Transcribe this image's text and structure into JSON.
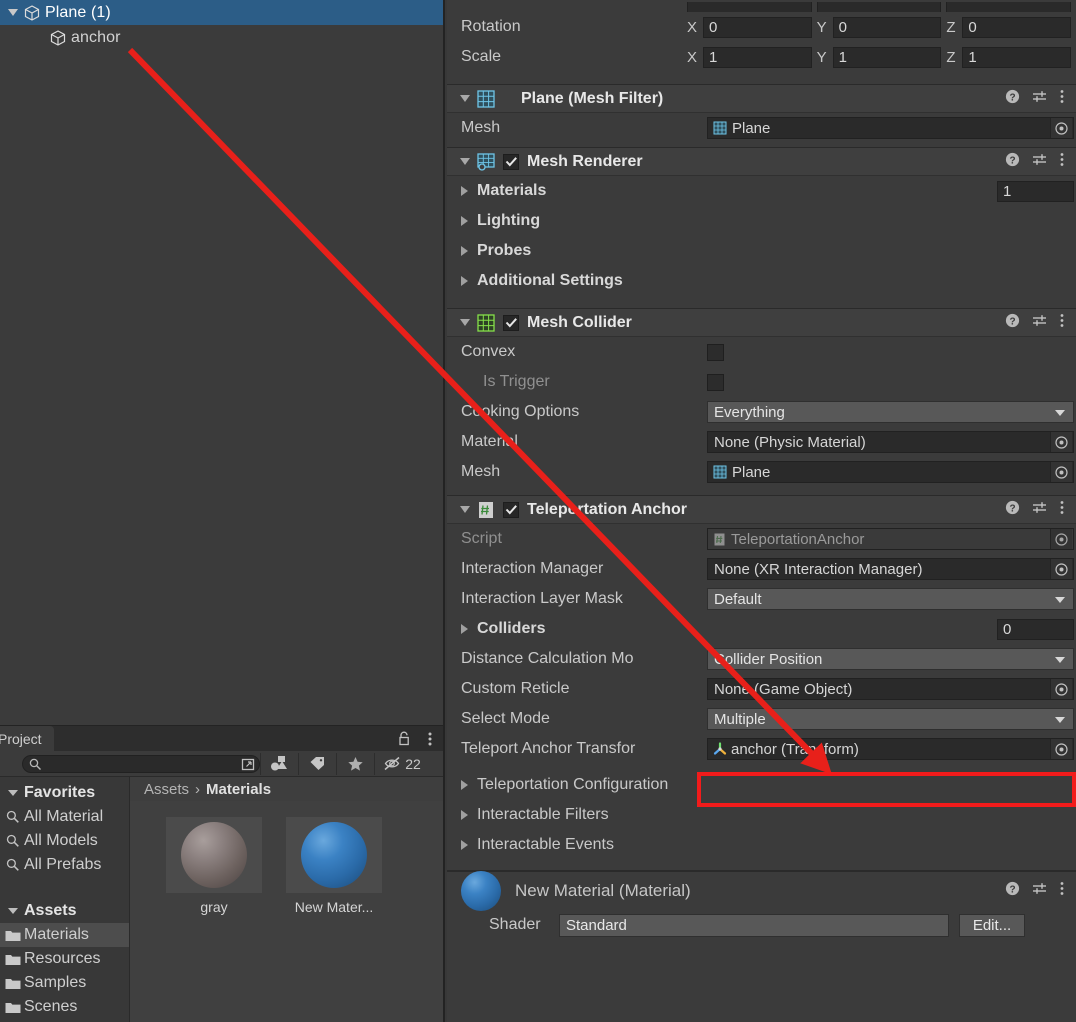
{
  "hierarchy": {
    "items": [
      {
        "label": "Plane (1)",
        "icon": "gameobject-icon",
        "selected": true,
        "expanded": true,
        "depth": 0
      },
      {
        "label": "anchor",
        "icon": "gameobject-icon",
        "selected": false,
        "expanded": false,
        "depth": 1
      }
    ]
  },
  "project": {
    "tab_label": "Project",
    "search_placeholder": "",
    "search_value": "",
    "hidden_count": "22",
    "tree": [
      {
        "label": "Favorites",
        "type": "header"
      },
      {
        "label": "All Material",
        "type": "search"
      },
      {
        "label": "All Models",
        "type": "search"
      },
      {
        "label": "All Prefabs",
        "type": "search"
      },
      {
        "label": "Assets",
        "type": "header"
      },
      {
        "label": "Materials",
        "type": "folder",
        "selected": true
      },
      {
        "label": "Resources",
        "type": "folder"
      },
      {
        "label": "Samples",
        "type": "folder"
      },
      {
        "label": "Scenes",
        "type": "folder"
      }
    ],
    "breadcrumb": [
      "Assets",
      "Materials"
    ],
    "assets": [
      {
        "name": "gray",
        "swatch": "gray"
      },
      {
        "name": "New Mater...",
        "swatch": "blue"
      }
    ]
  },
  "inspector": {
    "transform": {
      "rotation": {
        "label": "Rotation",
        "x": "0",
        "y": "0",
        "z": "0"
      },
      "scale": {
        "label": "Scale",
        "x": "1",
        "y": "1",
        "z": "1"
      },
      "axis_x": "X",
      "axis_y": "Y",
      "axis_z": "Z"
    },
    "mesh_filter": {
      "title": "Plane (Mesh Filter)",
      "mesh_label": "Mesh",
      "mesh_value": "Plane"
    },
    "mesh_renderer": {
      "title": "Mesh Renderer",
      "enabled": true,
      "sections": [
        "Materials",
        "Lighting",
        "Probes",
        "Additional Settings"
      ],
      "materials_count": "1"
    },
    "mesh_collider": {
      "title": "Mesh Collider",
      "enabled": true,
      "convex_label": "Convex",
      "convex_checked": false,
      "is_trigger_label": "Is Trigger",
      "is_trigger_checked": false,
      "cooking_label": "Cooking Options",
      "cooking_value": "Everything",
      "material_label": "Material",
      "material_value": "None (Physic Material)",
      "mesh_label": "Mesh",
      "mesh_value": "Plane"
    },
    "teleportation_anchor": {
      "title": "Teleportation Anchor",
      "enabled": true,
      "script_label": "Script",
      "script_value": "TeleportationAnchor",
      "interaction_manager_label": "Interaction Manager",
      "interaction_manager_value": "None (XR Interaction Manager)",
      "layer_mask_label": "Interaction Layer Mask",
      "layer_mask_value": "Default",
      "colliders_label": "Colliders",
      "colliders_count": "0",
      "distance_mode_label": "Distance Calculation Mo",
      "distance_mode_value": "Collider Position",
      "custom_reticle_label": "Custom Reticle",
      "custom_reticle_value": "None (Game Object)",
      "select_mode_label": "Select Mode",
      "select_mode_value": "Multiple",
      "anchor_transform_label": "Teleport Anchor Transfor",
      "anchor_transform_value": "anchor (Transform)",
      "foldouts": [
        "Teleportation Configuration",
        "Interactable Filters",
        "Interactable Events"
      ]
    },
    "material_preview": {
      "title": "New Material (Material)",
      "shader_label": "Shader",
      "shader_value": "Standard",
      "edit_label": "Edit..."
    }
  },
  "annotation": {
    "highlight_color": "#f21b1b",
    "arrow_color": "#e8201a",
    "arrow_from": "anchor",
    "arrow_to": "Teleport Anchor Transform field"
  }
}
